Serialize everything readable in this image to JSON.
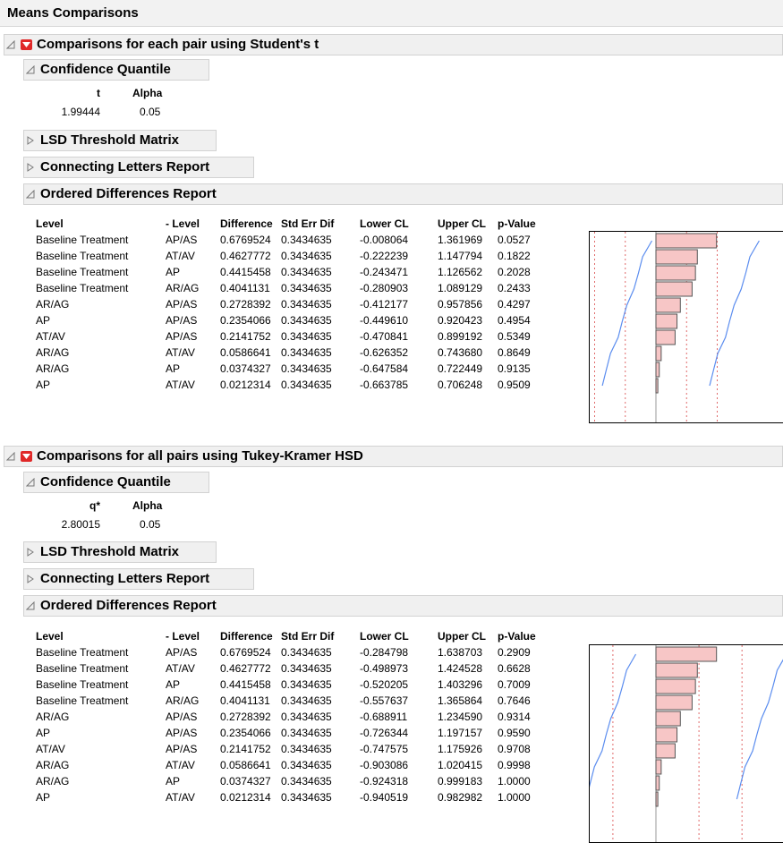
{
  "title": "Means Comparisons",
  "colors": {
    "bar_fill": "#f7c6c6",
    "bar_stroke": "#555555",
    "curve": "#5b8def",
    "threshold": "#e06a6a",
    "red_button": "#e02828"
  },
  "sections": [
    {
      "title": "Comparisons for each pair using Student's t",
      "confidence": {
        "title": "Confidence Quantile",
        "stat_label": "t",
        "alpha_label": "Alpha",
        "stat_value": "1.99444",
        "alpha_value": "0.05"
      },
      "lsd_title": "LSD Threshold Matrix",
      "letters_title": "Connecting Letters Report",
      "ordered_title": "Ordered Differences Report",
      "columns": [
        "Level",
        "- Level",
        "Difference",
        "Std Err Dif",
        "Lower CL",
        "Upper CL",
        "p-Value"
      ],
      "rows": [
        [
          "Baseline Treatment",
          "AP/AS",
          "0.6769524",
          "0.3434635",
          "-0.008064",
          "1.361969",
          "0.0527"
        ],
        [
          "Baseline Treatment",
          "AT/AV",
          "0.4627772",
          "0.3434635",
          "-0.222239",
          "1.147794",
          "0.1822"
        ],
        [
          "Baseline Treatment",
          "AP",
          "0.4415458",
          "0.3434635",
          "-0.243471",
          "1.126562",
          "0.2028"
        ],
        [
          "Baseline Treatment",
          "AR/AG",
          "0.4041131",
          "0.3434635",
          "-0.280903",
          "1.089129",
          "0.2433"
        ],
        [
          "AR/AG",
          "AP/AS",
          "0.2728392",
          "0.3434635",
          "-0.412177",
          "0.957856",
          "0.4297"
        ],
        [
          "AP",
          "AP/AS",
          "0.2354066",
          "0.3434635",
          "-0.449610",
          "0.920423",
          "0.4954"
        ],
        [
          "AT/AV",
          "AP/AS",
          "0.2141752",
          "0.3434635",
          "-0.470841",
          "0.899192",
          "0.5349"
        ],
        [
          "AR/AG",
          "AT/AV",
          "0.0586641",
          "0.3434635",
          "-0.626352",
          "0.743680",
          "0.8649"
        ],
        [
          "AR/AG",
          "AP",
          "0.0374327",
          "0.3434635",
          "-0.647584",
          "0.722449",
          "0.9135"
        ],
        [
          "AP",
          "AT/AV",
          "0.0212314",
          "0.3434635",
          "-0.663785",
          "0.706248",
          "0.9509"
        ]
      ]
    },
    {
      "title": "Comparisons for all pairs using Tukey-Kramer HSD",
      "confidence": {
        "title": "Confidence Quantile",
        "stat_label": "q*",
        "alpha_label": "Alpha",
        "stat_value": "2.80015",
        "alpha_value": "0.05"
      },
      "lsd_title": "LSD Threshold Matrix",
      "letters_title": "Connecting Letters Report",
      "ordered_title": "Ordered Differences Report",
      "columns": [
        "Level",
        "- Level",
        "Difference",
        "Std Err Dif",
        "Lower CL",
        "Upper CL",
        "p-Value"
      ],
      "rows": [
        [
          "Baseline Treatment",
          "AP/AS",
          "0.6769524",
          "0.3434635",
          "-0.284798",
          "1.638703",
          "0.2909"
        ],
        [
          "Baseline Treatment",
          "AT/AV",
          "0.4627772",
          "0.3434635",
          "-0.498973",
          "1.424528",
          "0.6628"
        ],
        [
          "Baseline Treatment",
          "AP",
          "0.4415458",
          "0.3434635",
          "-0.520205",
          "1.403296",
          "0.7009"
        ],
        [
          "Baseline Treatment",
          "AR/AG",
          "0.4041131",
          "0.3434635",
          "-0.557637",
          "1.365864",
          "0.7646"
        ],
        [
          "AR/AG",
          "AP/AS",
          "0.2728392",
          "0.3434635",
          "-0.688911",
          "1.234590",
          "0.9314"
        ],
        [
          "AP",
          "AP/AS",
          "0.2354066",
          "0.3434635",
          "-0.726344",
          "1.197157",
          "0.9590"
        ],
        [
          "AT/AV",
          "AP/AS",
          "0.2141752",
          "0.3434635",
          "-0.747575",
          "1.175926",
          "0.9708"
        ],
        [
          "AR/AG",
          "AT/AV",
          "0.0586641",
          "0.3434635",
          "-0.903086",
          "1.020415",
          "0.9998"
        ],
        [
          "AR/AG",
          "AP",
          "0.0374327",
          "0.3434635",
          "-0.924318",
          "0.999183",
          "1.0000"
        ],
        [
          "AP",
          "AT/AV",
          "0.0212314",
          "0.3434635",
          "-0.940519",
          "0.982982",
          "1.0000"
        ]
      ]
    }
  ],
  "chart_data": [
    {
      "type": "bar",
      "values": [
        0.6769524,
        0.4627772,
        0.4415458,
        0.4041131,
        0.2728392,
        0.2354066,
        0.2141752,
        0.0586641,
        0.0374327,
        0.0212314
      ],
      "threshold": 0.685,
      "orientation": "horizontal"
    },
    {
      "type": "bar",
      "values": [
        0.6769524,
        0.4627772,
        0.4415458,
        0.4041131,
        0.2728392,
        0.2354066,
        0.2141752,
        0.0586641,
        0.0374327,
        0.0212314
      ],
      "threshold": 0.9618,
      "orientation": "horizontal"
    }
  ]
}
